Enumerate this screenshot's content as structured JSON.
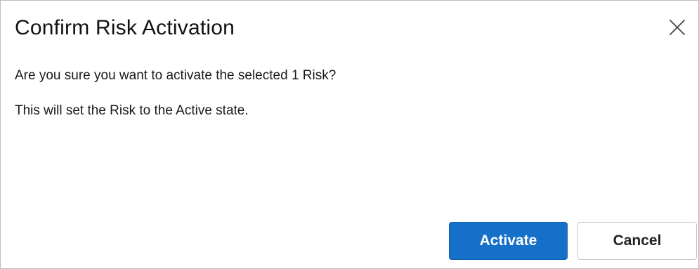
{
  "dialog": {
    "title": "Confirm Risk Activation",
    "message_line1": "Are you sure you want to activate the selected 1 Risk?",
    "message_line2": "This will set the Risk to the Active state.",
    "close_icon": "close-icon"
  },
  "buttons": {
    "activate_label": "Activate",
    "cancel_label": "Cancel"
  },
  "colors": {
    "primary": "#1570c9",
    "primary_text": "#ffffff",
    "secondary_border": "#c8c8c8",
    "dialog_border": "#bdbdbd"
  }
}
